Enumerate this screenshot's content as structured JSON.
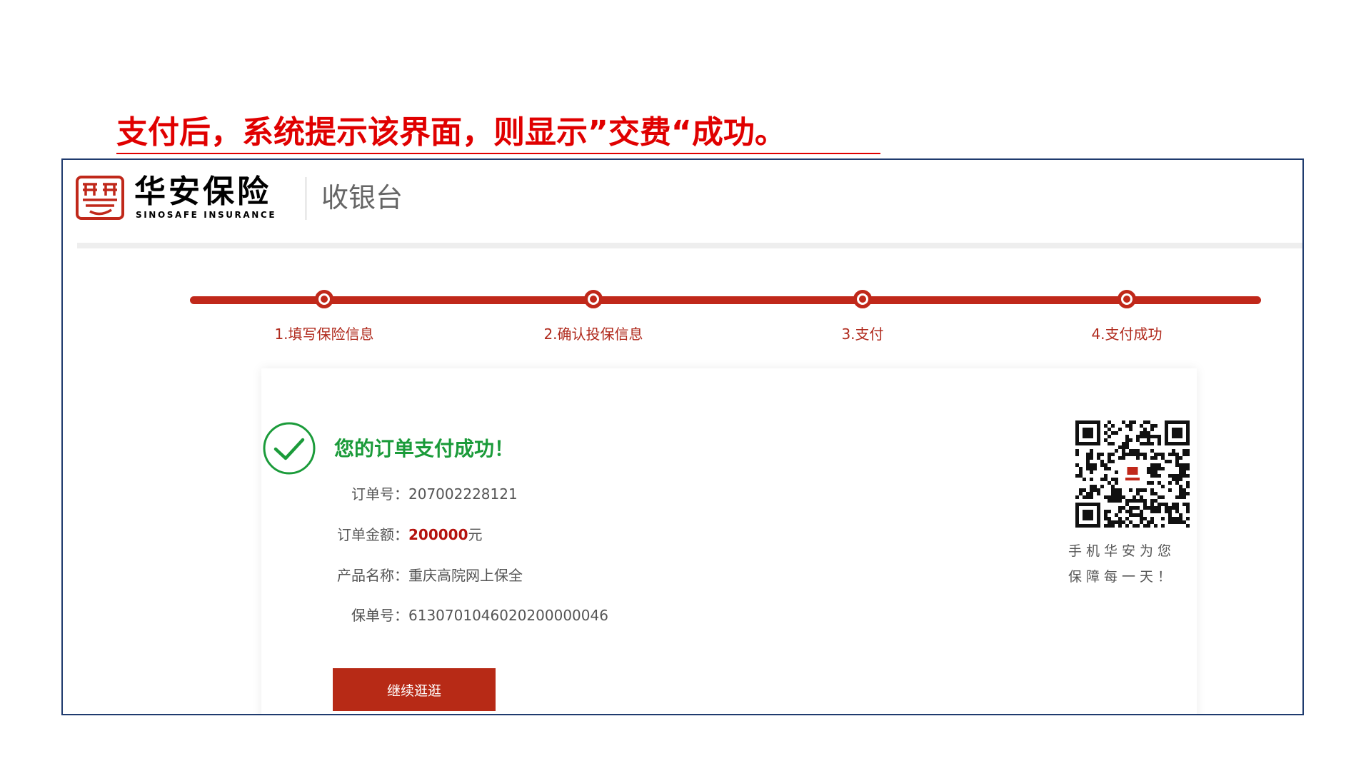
{
  "slide": {
    "caption": "支付后，系统提示该界面，则显示”交费“成功。"
  },
  "header": {
    "brand_cn": "华安保险",
    "brand_en": "SINOSAFE INSURANCE",
    "title": "收银台",
    "logo_icon": "sinosafe-seal-logo",
    "brand_color": "#c0281a"
  },
  "steps": [
    {
      "label": "1.填写保险信息"
    },
    {
      "label": "2.确认投保信息"
    },
    {
      "label": "3.支付"
    },
    {
      "label": "4.支付成功"
    }
  ],
  "result": {
    "icon": "check-circle-icon",
    "title": "您的订单支付成功！",
    "order_no_label": "订单号：",
    "order_no": "207002228121",
    "amount_label": "订单金额：",
    "amount": "200000",
    "amount_unit": "元",
    "product_label": "产品名称：",
    "product": "重庆高院网上保全",
    "policy_no_label": "保单号：",
    "policy_no": "6130701046020200000046",
    "button_label": "继续逛逛",
    "success_color": "#1b9b3a",
    "amount_color": "#b5130e"
  },
  "qr": {
    "icon": "qr-code-icon",
    "caption_line1": "手机华安为您",
    "caption_line2": "保障每一天！"
  }
}
